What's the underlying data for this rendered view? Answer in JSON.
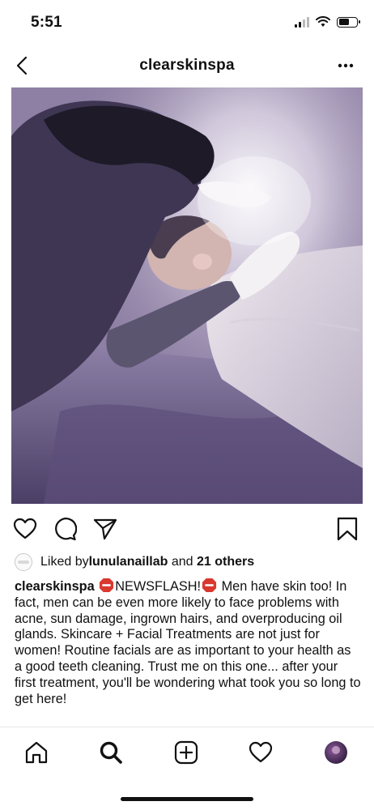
{
  "status_bar": {
    "time": "5:51",
    "icons": [
      "signal-icon",
      "wifi-icon",
      "battery-icon"
    ]
  },
  "nav": {
    "title": "clearskinspa",
    "back_icon": "chevron-left-icon",
    "more_icon": "more-horizontal-icon"
  },
  "post": {
    "image_icon": "post-photo",
    "actions": [
      "heart-icon",
      "comment-icon",
      "send-icon",
      "bookmark-icon"
    ],
    "likes": {
      "prefix": "Liked by ",
      "user": "lunulanaillab",
      "middle": " and ",
      "others": "21 others"
    },
    "caption": {
      "username": "clearskinspa",
      "newsflash": "NEWSFLASH!",
      "text": " Men have skin too! In fact, men can be even more likely to face problems with acne, sun damage, ingrown hairs, and overproducing oil glands. Skincare + Facial Treatments are not just for women! Routine facials are as important to your health as a good teeth cleaning.  Trust me on this one... after your first treatment, you'll be wondering what took you so long to get here!"
    }
  },
  "tab_bar": {
    "tabs": [
      "home-icon",
      "search-icon",
      "new-post-icon",
      "activity-icon",
      "profile-avatar"
    ],
    "active": "search-icon"
  },
  "colors": {
    "text": "#111111",
    "stop_red": "#d9382f",
    "divider": "#e6e6e6"
  }
}
